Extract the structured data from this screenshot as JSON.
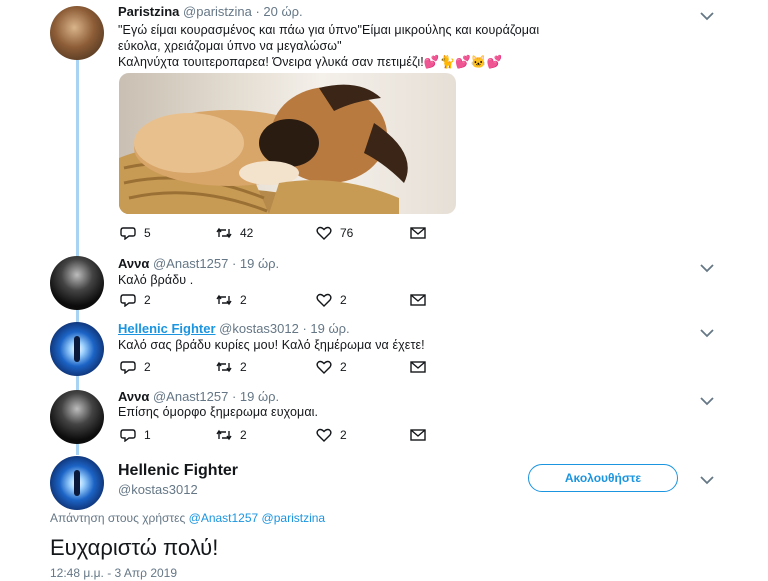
{
  "tweets": [
    {
      "name": "Paristzina",
      "handle": "@paristzina · 20 ώρ.",
      "lines": [
        "\"Εγώ είμαι κουρασμένος και πάω για ύπνο\"Είμαι μικρούλης και κουράζομαι",
        "εύκολα, χρειάζομαι ύπνο να μεγαλώσω\"",
        "Καληνύχτα τουιτεροπαρεα! Όνειρα γλυκά σαν πετιμέζι!💕🐈💕🐱💕"
      ],
      "replies": "5",
      "retweets": "42",
      "likes": "76"
    },
    {
      "name": "Αννα",
      "handle": "@Anast1257 · 19 ώρ.",
      "text": "Καλό βράδυ .",
      "replies": "2",
      "retweets": "2",
      "likes": "2"
    },
    {
      "name": "Hellenic Fighter",
      "handle": "@kostas3012 · 19 ώρ.",
      "text": "Καλό σας βράδυ κυρίες μου! Καλό ξημέρωμα να έχετε!",
      "replies": "2",
      "retweets": "2",
      "likes": "2"
    },
    {
      "name": "Αννα",
      "handle": "@Anast1257 · 19 ώρ.",
      "text": "Επίσης όμορφο ξημερωμα ευχομαι.",
      "replies": "1",
      "retweets": "2",
      "likes": "2"
    }
  ],
  "main": {
    "name": "Hellenic Fighter",
    "handle": "@kostas3012",
    "follow_label": "Ακολουθήστε",
    "reply_prefix": "Απάντηση στους χρήστες",
    "mention1": "@Anast1257",
    "mention2": "@paristzina",
    "text": "Ευχαριστώ πολύ!",
    "timestamp": "12:48 μ.μ. - 3 Απρ 2019"
  },
  "colors": {
    "accent": "#1b95e0",
    "thread": "#a8d3f2",
    "muted": "#657786"
  },
  "icons": [
    "reply-icon",
    "retweet-icon",
    "like-icon",
    "message-icon",
    "chevron-down-icon"
  ]
}
